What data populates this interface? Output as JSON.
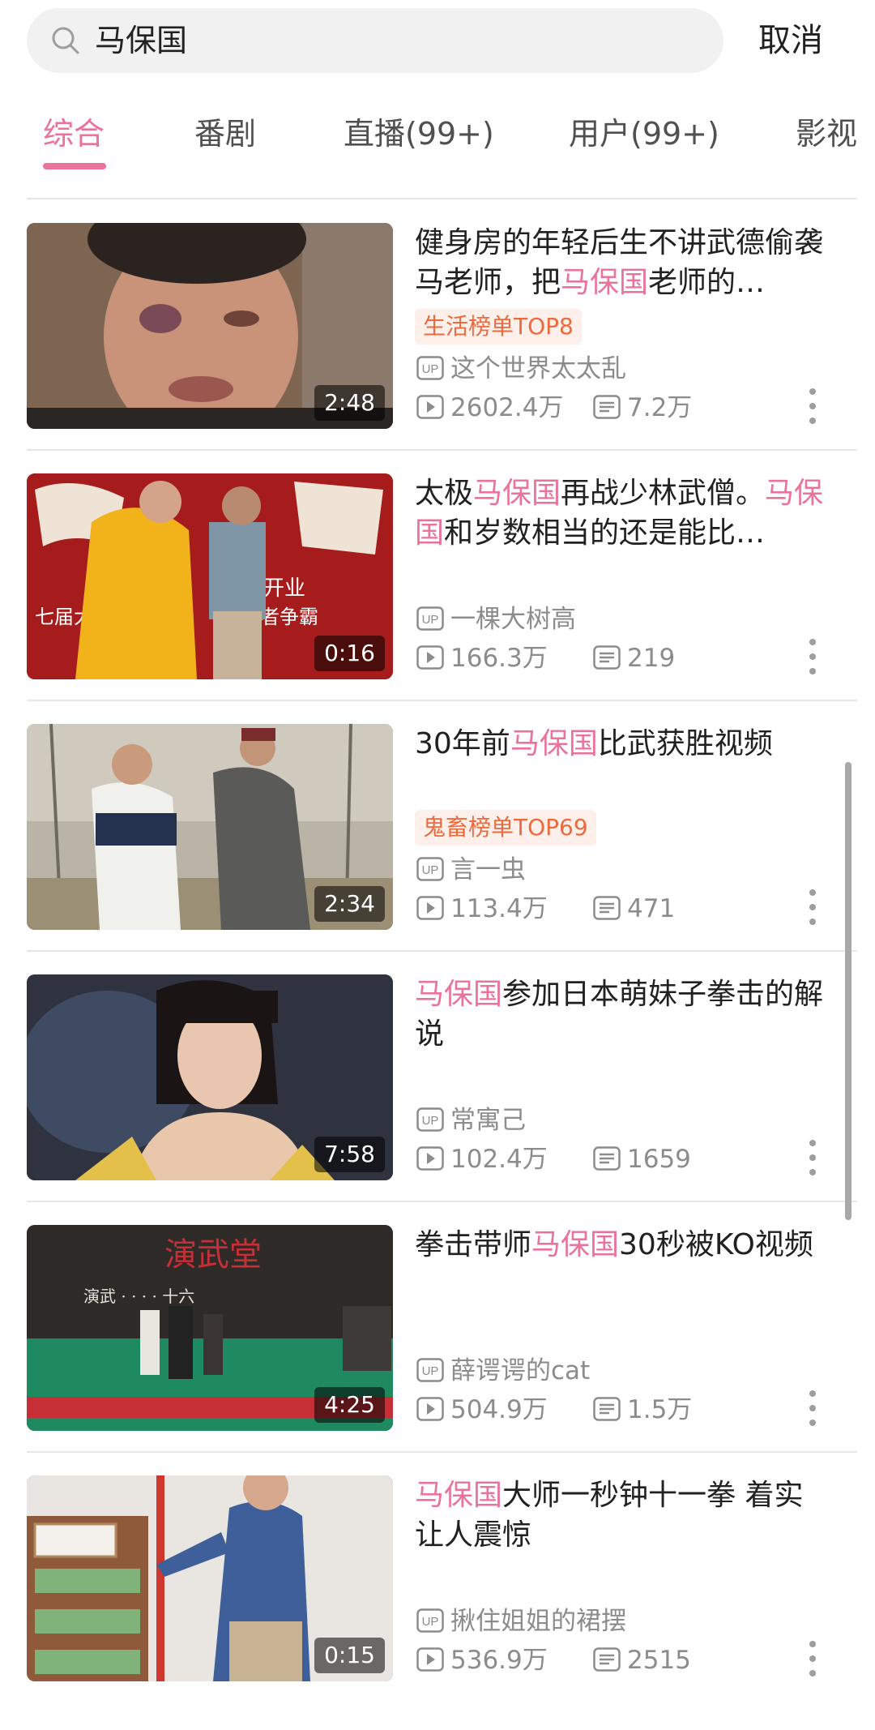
{
  "search": {
    "query": "马保国",
    "cancel_label": "取消"
  },
  "tabs": [
    {
      "label": "综合",
      "active": true
    },
    {
      "label": "番剧"
    },
    {
      "label": "直播(99+)"
    },
    {
      "label": "用户(99+)"
    },
    {
      "label": "影视"
    }
  ],
  "colors": {
    "accent": "#e9739b",
    "badge_text": "#ed6a3e",
    "badge_bg": "#fdf0ea",
    "meta": "#8c8c8c"
  },
  "videos": [
    {
      "title_parts": [
        "健身房的年轻后生不讲武德偷袭马老师，把",
        "马保国",
        "老师的…"
      ],
      "title_highlight": [
        false,
        true,
        false
      ],
      "badge": "生活榜单TOP8",
      "uploader": "这个世界太太乱",
      "views": "2602.4万",
      "comments": "7.2万",
      "duration": "2:48"
    },
    {
      "title_parts": [
        "太极",
        "马保国",
        "再战少林武僧。",
        "马保国",
        "和岁数相当的还是能比…"
      ],
      "title_highlight": [
        false,
        true,
        false,
        true,
        false
      ],
      "badge": "",
      "uploader": "一棵大树高",
      "views": "166.3万",
      "comments": "219",
      "duration": "0:16"
    },
    {
      "title_parts": [
        "30年前",
        "马保国",
        "比武获胜视频"
      ],
      "title_highlight": [
        false,
        true,
        false
      ],
      "badge": "鬼畜榜单TOP69",
      "uploader": "言一虫",
      "views": "113.4万",
      "comments": "471",
      "duration": "2:34"
    },
    {
      "title_parts": [
        "马保国",
        "参加日本萌妹子拳击的解说"
      ],
      "title_highlight": [
        true,
        false
      ],
      "badge": "",
      "uploader": "常寓己",
      "views": "102.4万",
      "comments": "1659",
      "duration": "7:58"
    },
    {
      "title_parts": [
        "拳击带师",
        "马保国",
        "30秒被KO视频"
      ],
      "title_highlight": [
        false,
        true,
        false
      ],
      "badge": "",
      "uploader": "薛谔谔的cat",
      "views": "504.9万",
      "comments": "1.5万",
      "duration": "4:25"
    },
    {
      "title_parts": [
        "马保国",
        "大师一秒钟十一拳  着实让人震惊"
      ],
      "title_highlight": [
        true,
        false
      ],
      "badge": "",
      "uploader": "揪住姐姐的裙摆",
      "views": "536.9万",
      "comments": "2515",
      "duration": "0:15"
    }
  ]
}
